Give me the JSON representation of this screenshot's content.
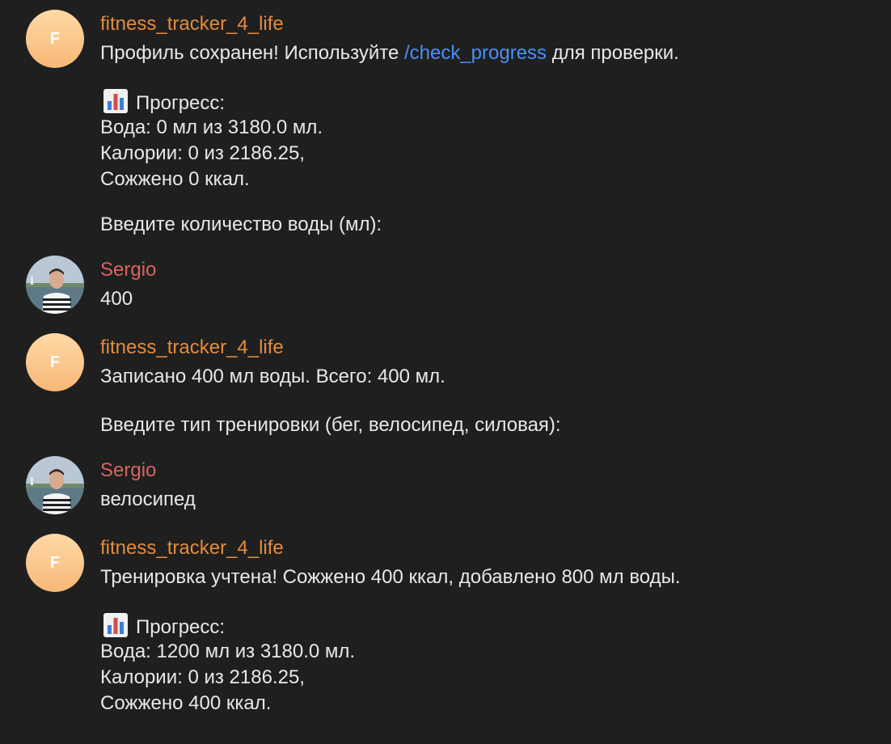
{
  "bot": {
    "name": "fitness_tracker_4_life",
    "avatar_letter": "F",
    "avatar_gradient": [
      "#ffd9a6",
      "#f7b877"
    ],
    "name_color": "#e38c3d"
  },
  "user": {
    "name": "Sergio",
    "name_color": "#d9655f"
  },
  "messages": [
    {
      "line1_prefix": "Профиль сохранен! Используйте ",
      "line1_link": "/check_progress",
      "line1_suffix": " для проверки.",
      "progress_title": "Прогресс:",
      "water": "Вода: 0 мл из 3180.0 мл.",
      "calories": "Калории: 0 из 2186.25,",
      "burned": "Сожжено 0 ккал.",
      "prompt": "Введите количество воды (мл):"
    },
    {
      "text": "400"
    },
    {
      "line1": "Записано 400 мл воды. Всего: 400 мл.",
      "prompt": "Введите тип тренировки (бег, велосипед, силовая):"
    },
    {
      "text": "велосипед"
    },
    {
      "line1": "Тренировка учтена! Сожжено 400 ккал, добавлено 800 мл воды.",
      "progress_title": "Прогресс:",
      "water": "Вода: 1200 мл из 3180.0 мл.",
      "calories": "Калории: 0 из 2186.25,",
      "burned": "Сожжено 400 ккал."
    }
  ],
  "icons": {
    "progress": "bar-chart-icon",
    "link_color": "#4a8ff7"
  }
}
